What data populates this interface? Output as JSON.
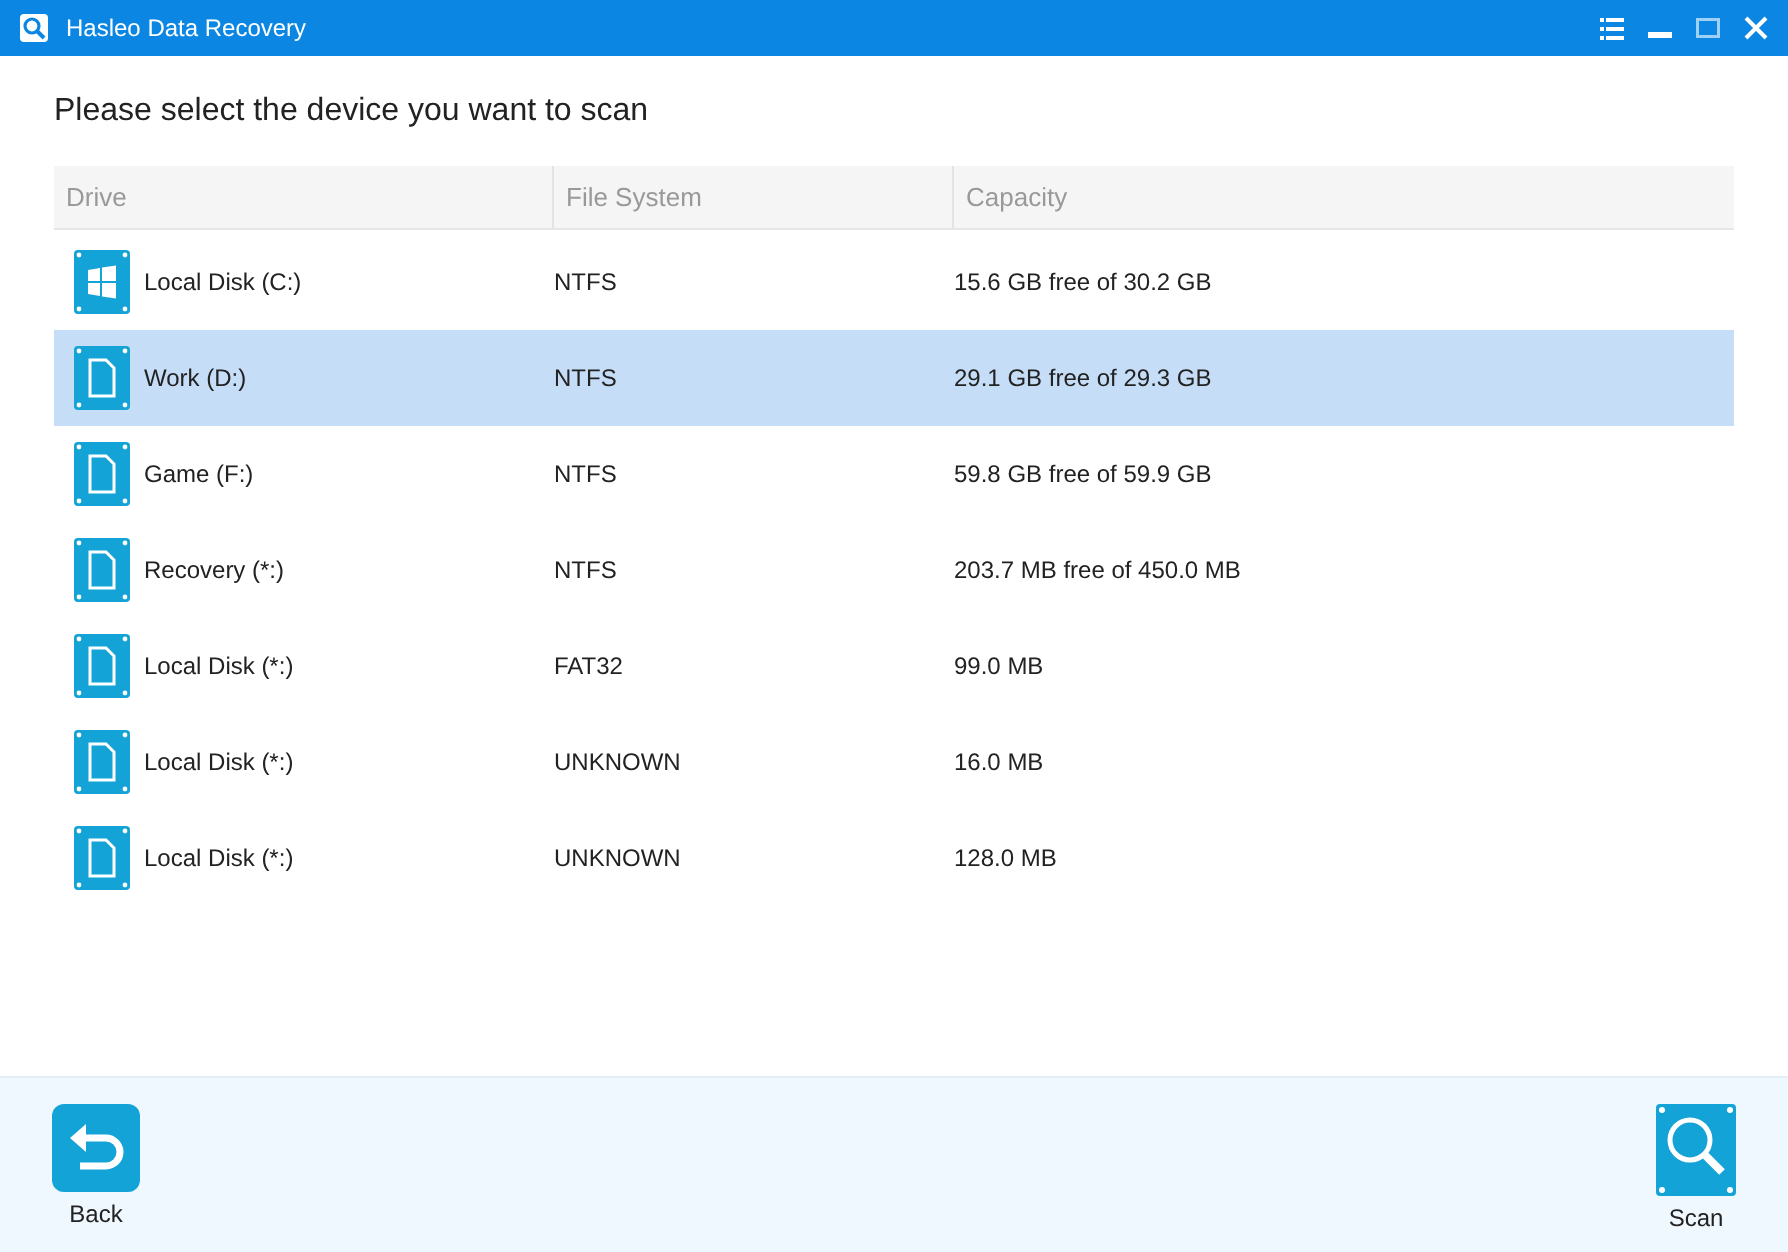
{
  "window": {
    "title": "Hasleo Data Recovery"
  },
  "heading": "Please select the device you want to scan",
  "table": {
    "columns": [
      "Drive",
      "File System",
      "Capacity"
    ],
    "rows": [
      {
        "kind": "system",
        "drive": "Local Disk (C:)",
        "file_system": "NTFS",
        "capacity": "15.6 GB free of 30.2 GB",
        "selected": false
      },
      {
        "kind": "file",
        "drive": "Work (D:)",
        "file_system": "NTFS",
        "capacity": "29.1 GB free of 29.3 GB",
        "selected": true
      },
      {
        "kind": "file",
        "drive": "Game (F:)",
        "file_system": "NTFS",
        "capacity": "59.8 GB free of 59.9 GB",
        "selected": false
      },
      {
        "kind": "file",
        "drive": "Recovery (*:)",
        "file_system": "NTFS",
        "capacity": "203.7 MB free of 450.0 MB",
        "selected": false
      },
      {
        "kind": "file",
        "drive": "Local Disk (*:)",
        "file_system": "FAT32",
        "capacity": "99.0 MB",
        "selected": false
      },
      {
        "kind": "file",
        "drive": "Local Disk (*:)",
        "file_system": "UNKNOWN",
        "capacity": "16.0 MB",
        "selected": false
      },
      {
        "kind": "file",
        "drive": "Local Disk (*:)",
        "file_system": "UNKNOWN",
        "capacity": "128.0 MB",
        "selected": false
      }
    ]
  },
  "buttons": [
    {
      "kind": "back",
      "label": "Back"
    },
    {
      "kind": "scan",
      "label": "Scan"
    }
  ]
}
